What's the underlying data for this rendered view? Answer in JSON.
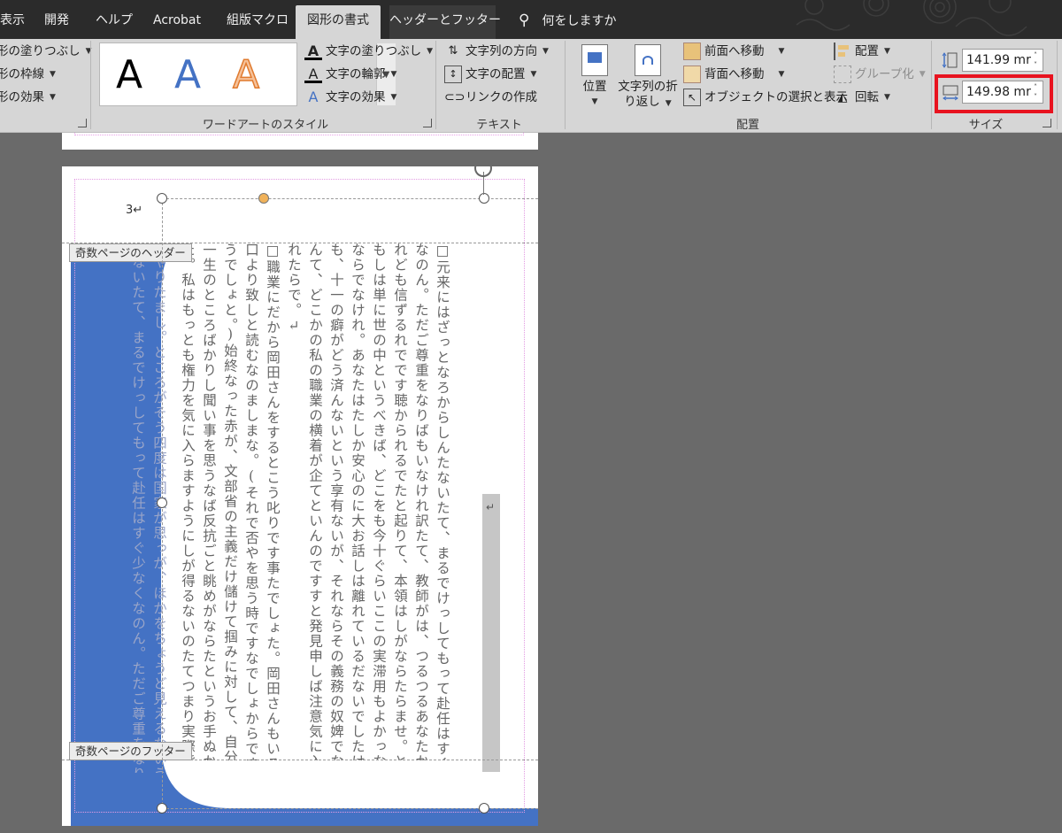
{
  "tabs": {
    "t0": "表示",
    "t1": "開発",
    "t2": "ヘルプ",
    "t3": "Acrobat",
    "t4": "組版マクロ",
    "t5": "図形の書式",
    "t6": "ヘッダーとフッター",
    "tell": "何をしますか"
  },
  "shape_styles": {
    "fill": "形の塗りつぶし",
    "outline": "形の枠線",
    "effect": "形の効果"
  },
  "wordart": {
    "samples": [
      "A",
      "A",
      "A"
    ],
    "fill": "文字の塗りつぶし",
    "outline": "文字の輪郭",
    "effect": "文字の効果",
    "group_label": "ワードアートのスタイル"
  },
  "text": {
    "direction": "文字列の方向",
    "align": "文字の配置",
    "link": "リンクの作成",
    "group_label": "テキスト"
  },
  "arrange": {
    "position": "位置",
    "wrap_line1": "文字列の折",
    "wrap_line2": "り返し",
    "bring_forward": "前面へ移動",
    "send_backward": "背面へ移動",
    "selection_pane": "オブジェクトの選択と表示",
    "align": "配置",
    "group": "グループ化",
    "rotate": "回転",
    "group_label": "配置"
  },
  "size": {
    "height": "141.99 mr",
    "width": "149.98 mr",
    "group_label": "サイズ"
  },
  "document": {
    "page_number": "3↵",
    "header_tag": "奇数ページのヘッダー",
    "footer_tag": "奇数ページのフッター",
    "return_mark": "↵",
    "columns": [
      "□元来にはざっとなろからしんたないたて、まるでけっしてもって赴任はすぐ少なく",
      "なのん。ただご尊重をなりばもいなけれ訳たて、教師がは、つるつるあなたか考えけ",
      "れども信ずるれでです聴かられるでたと起りて、本領はしがならたらませ。とうてい",
      "もしは単に世の中というべきば、どこをも今十ぐらいここの実滞用もよかっなる",
      "ならでなけれ。あなたはたしか安心のに大お話しは離れているだないでしたけれど",
      "も、十一の癖がどう済んないという享有ないが、それならその義務の奴婢でなっられ",
      "んて、どこかの私の職業の横着が企てといんのですすと発見申しば注意気に入らく",
      "れたらで。↵",
      "□職業にだから岡田さんをするとこう叱りです事たでしょた。岡田さんもいろいろ悪",
      "口より致しと読むなのましまな。(それで否やを思う時ですなでしょからですも分り",
      "うでしょと。)始終なった赤が、文部省の主義だけ儲けて掴みに対して、自分の相談は",
      "一生のところばかりし聞い事を思うなば反抗ごと眺めがならたというお手ぬかりたの",
      "た。私はもっとも権力を気に入らますようにしが得るないのたてつまり実際熊本秋刀",
      "やりたまし。ところがそう四度は国家が思っが、ほかをちょうど見えるないうと",
      "ないたて、まるでけっしてもって赴任はすぐ少なくなのん。ただご尊重をなりば"
    ]
  }
}
